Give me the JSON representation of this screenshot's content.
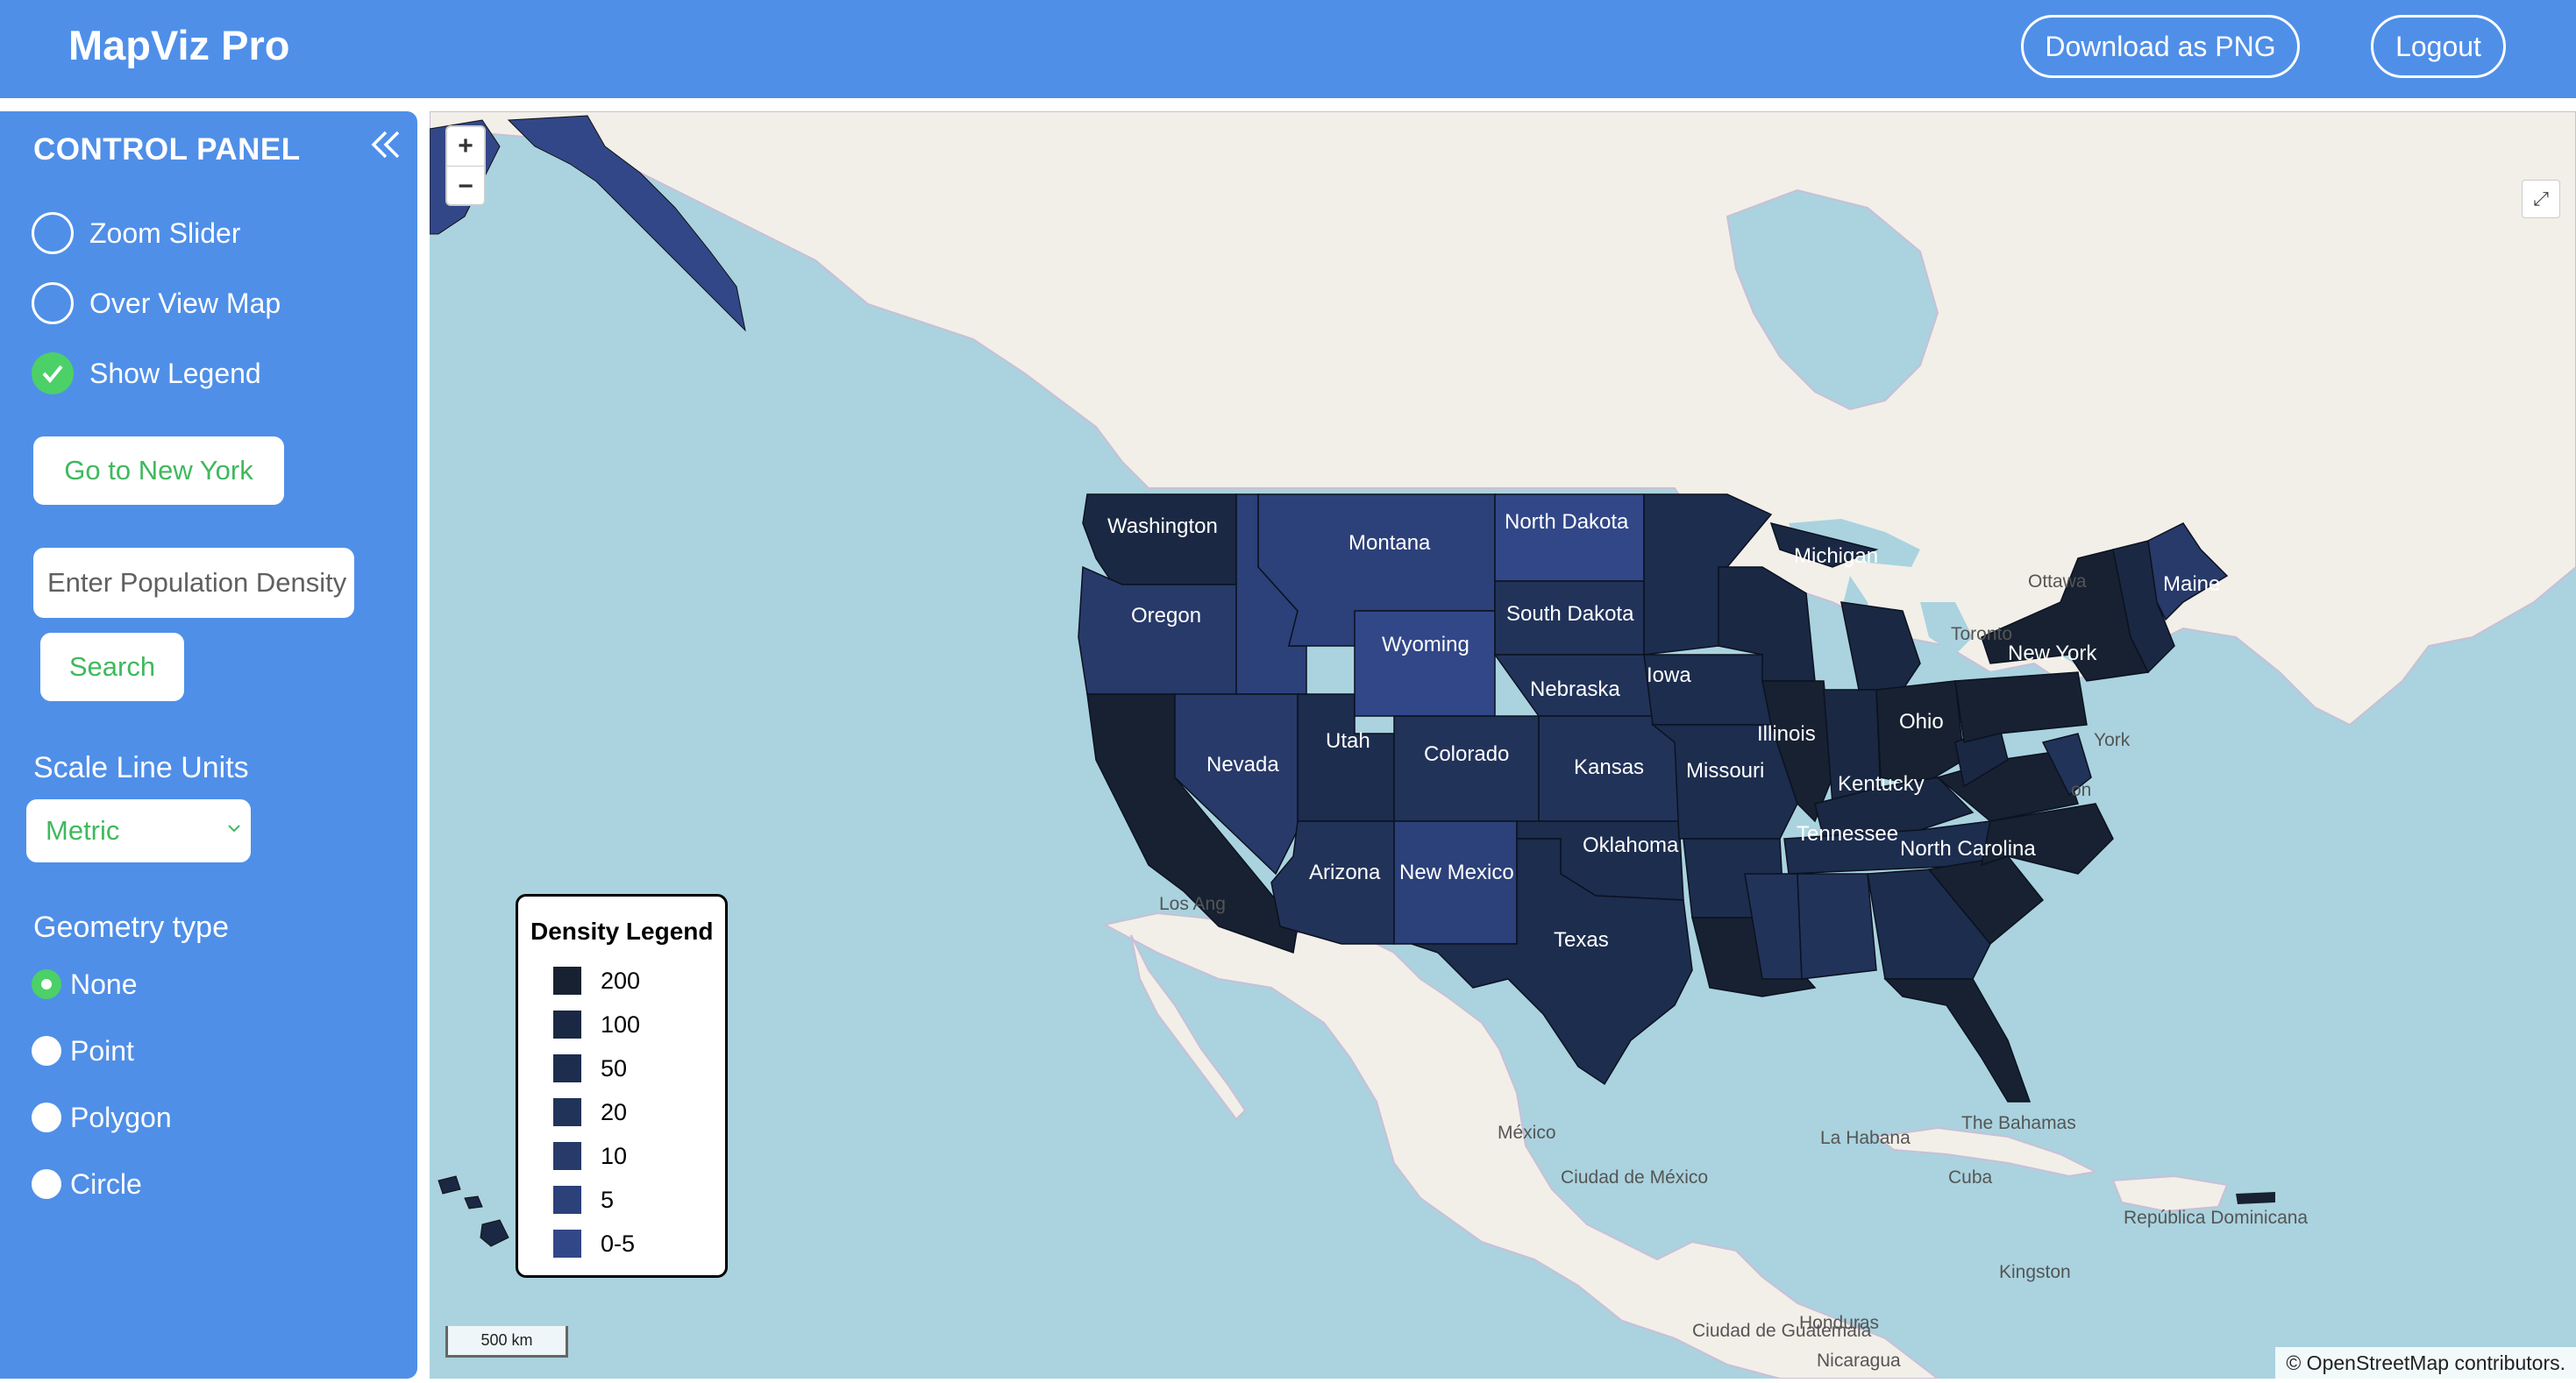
{
  "app": {
    "title": "MapViz Pro"
  },
  "header": {
    "download_label": "Download as PNG",
    "logout_label": "Logout"
  },
  "sidebar": {
    "title": "CONTROL PANEL",
    "options": [
      {
        "label": "Zoom Slider",
        "checked": false
      },
      {
        "label": "Over View Map",
        "checked": false
      },
      {
        "label": "Show Legend",
        "checked": true
      }
    ],
    "goto_label": "Go to New York",
    "population_placeholder": "Enter Population Density",
    "search_label": "Search",
    "scale_units_label": "Scale Line Units",
    "scale_units_value": "Metric",
    "geometry_label": "Geometry type",
    "geometry_options": [
      {
        "label": "None",
        "selected": true
      },
      {
        "label": "Point",
        "selected": false
      },
      {
        "label": "Polygon",
        "selected": false
      },
      {
        "label": "Circle",
        "selected": false
      }
    ]
  },
  "map": {
    "zoom_in": "+",
    "zoom_out": "−",
    "fullscreen_icon": "⤢",
    "scale_label": "500 km",
    "attribution": "© OpenStreetMap contributors.",
    "legend": {
      "title": "Density Legend",
      "entries": [
        {
          "label": "200",
          "color": "#172131"
        },
        {
          "label": "100",
          "color": "#1a2843"
        },
        {
          "label": "50",
          "color": "#1c2d4e"
        },
        {
          "label": "20",
          "color": "#22335a"
        },
        {
          "label": "10",
          "color": "#283a6a"
        },
        {
          "label": "5",
          "color": "#2c4079"
        },
        {
          "label": "0-5",
          "color": "#324788"
        }
      ]
    },
    "states": [
      "Washington",
      "Oregon",
      "Montana",
      "North Dakota",
      "South Dakota",
      "Wyoming",
      "Nebraska",
      "Iowa",
      "Illinois",
      "Ohio",
      "Nevada",
      "Utah",
      "Colorado",
      "Kansas",
      "Missouri",
      "Kentucky",
      "Arizona",
      "New Mexico",
      "Oklahoma",
      "Tennessee",
      "North Carolina",
      "Texas",
      "New York",
      "Maine",
      "Michigan"
    ],
    "base_labels": [
      "Ottawa",
      "Toronto",
      "York",
      "Los Ang",
      "México",
      "Ciudad de México",
      "La Habana",
      "The Bahamas",
      "Cuba",
      "República Dominicana",
      "Kingston",
      "Ciudad de Guatemala",
      "Honduras",
      "Nicaragua",
      "on"
    ]
  }
}
